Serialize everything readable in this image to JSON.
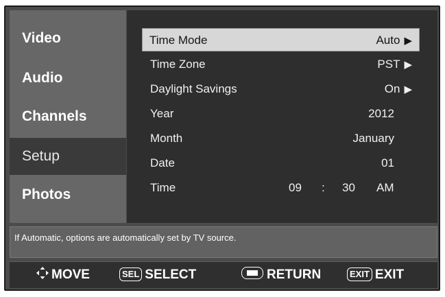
{
  "nav": {
    "items": [
      {
        "label": "Video"
      },
      {
        "label": "Audio"
      },
      {
        "label": "Channels"
      },
      {
        "label": "Setup"
      },
      {
        "label": "Photos"
      }
    ]
  },
  "settings": {
    "time_mode": {
      "label": "Time Mode",
      "value": "Auto"
    },
    "time_zone": {
      "label": "Time Zone",
      "value": "PST"
    },
    "daylight_savings": {
      "label": "Daylight Savings",
      "value": "On"
    },
    "year": {
      "label": "Year",
      "value": "2012"
    },
    "month": {
      "label": "Month",
      "value": "January"
    },
    "date": {
      "label": "Date",
      "value": "01"
    },
    "time": {
      "label": "Time",
      "hour": "09",
      "separator": ":",
      "minute": "30",
      "ampm": "AM"
    }
  },
  "arrow_glyph": "▶",
  "hint": "If Automatic, options are automatically set by TV source.",
  "footer": {
    "move": "MOVE",
    "sel_key": "SEL",
    "select": "SELECT",
    "return": "RETURN",
    "exit_key": "EXIT",
    "exit": "EXIT"
  },
  "colors": {
    "nav_active": "#3a3a3a",
    "selected_row": "#d7d7d7",
    "panel": "#2e2e2e"
  },
  "active_nav": "Setup",
  "selected_setting": "Time Mode"
}
